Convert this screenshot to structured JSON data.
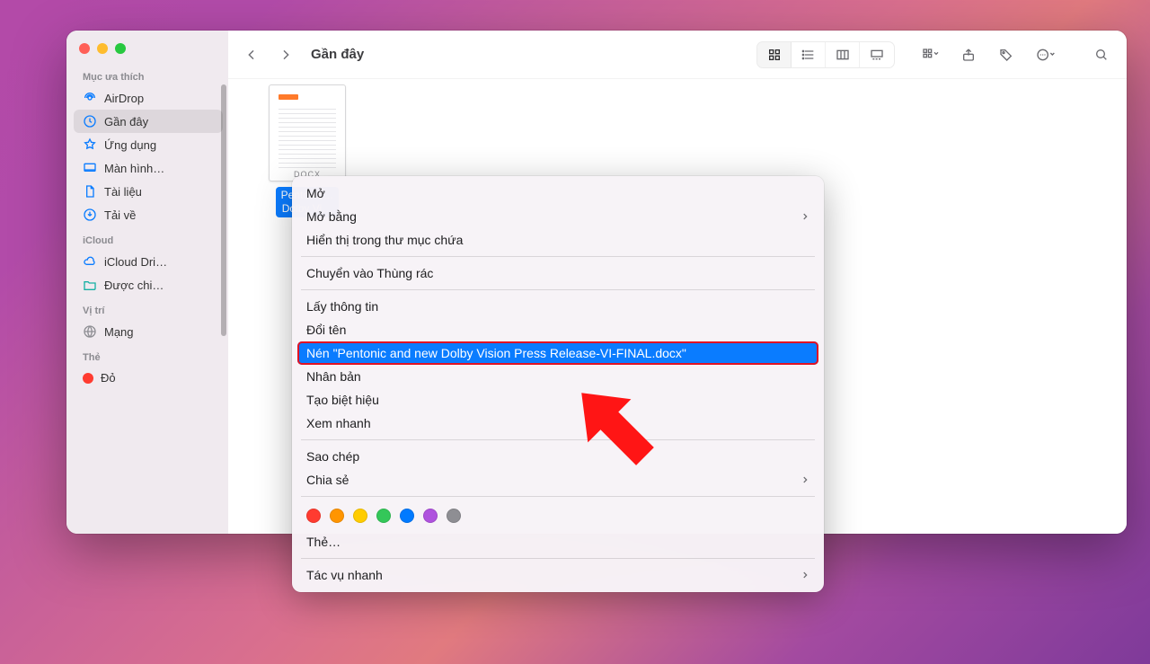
{
  "sidebar": {
    "sections": {
      "favorites_header": "Mục ưa thích",
      "icloud_header": "iCloud",
      "locations_header": "Vị trí",
      "tags_header": "Thẻ"
    },
    "favorites": [
      {
        "label": "AirDrop",
        "icon": "airdrop-icon"
      },
      {
        "label": "Gần đây",
        "icon": "clock-icon",
        "selected": true
      },
      {
        "label": "Ứng dụng",
        "icon": "apps-icon"
      },
      {
        "label": "Màn hình…",
        "icon": "desktop-icon"
      },
      {
        "label": "Tài liệu",
        "icon": "document-icon"
      },
      {
        "label": "Tải về",
        "icon": "download-icon"
      }
    ],
    "icloud": [
      {
        "label": "iCloud Dri…",
        "icon": "cloud-icon"
      },
      {
        "label": "Được chi…",
        "icon": "folder-icon"
      }
    ],
    "locations": [
      {
        "label": "Mạng",
        "icon": "network-icon"
      }
    ],
    "tags": [
      {
        "label": "Đỏ",
        "color": "#ff3b30"
      }
    ]
  },
  "toolbar": {
    "title": "Gần đây"
  },
  "file": {
    "label": "Pentonic…\nDolby Vi…",
    "ext": "DOCX"
  },
  "contextMenu": {
    "open": "Mở",
    "openWith": "Mở bằng",
    "showInFolder": "Hiển thị trong thư mục chứa",
    "moveToTrash": "Chuyển vào Thùng rác",
    "getInfo": "Lấy thông tin",
    "rename": "Đổi tên",
    "compress": "Nén \"Pentonic and new Dolby Vision Press Release-VI-FINAL.docx\"",
    "duplicate": "Nhân bản",
    "makeAlias": "Tạo biệt hiệu",
    "quickLook": "Xem nhanh",
    "copy": "Sao chép",
    "share": "Chia sẻ",
    "tagsLabel": "Thẻ…",
    "quickActions": "Tác vụ nhanh",
    "tagColors": [
      "#ff3b30",
      "#ff9500",
      "#ffcc00",
      "#34c759",
      "#007aff",
      "#af52de",
      "#8e8e93"
    ]
  }
}
